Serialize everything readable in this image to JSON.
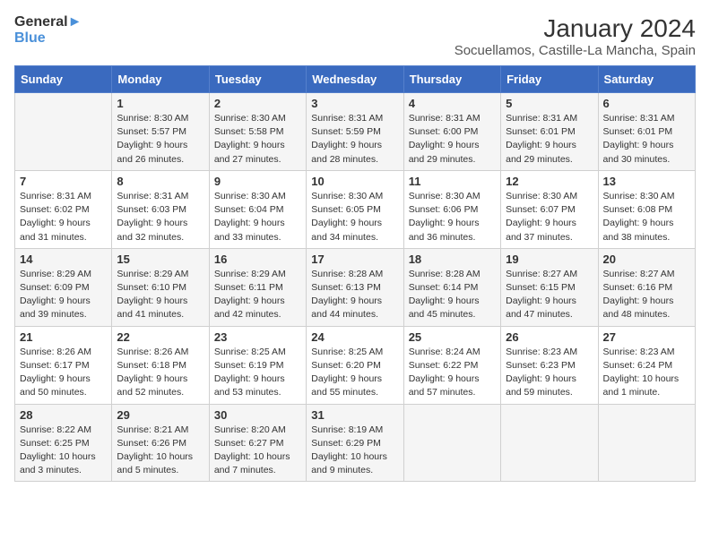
{
  "logo": {
    "line1": "General",
    "line2": "Blue"
  },
  "title": "January 2024",
  "location": "Socuellamos, Castille-La Mancha, Spain",
  "days_of_week": [
    "Sunday",
    "Monday",
    "Tuesday",
    "Wednesday",
    "Thursday",
    "Friday",
    "Saturday"
  ],
  "weeks": [
    [
      {
        "num": "",
        "sunrise": "",
        "sunset": "",
        "daylight": ""
      },
      {
        "num": "1",
        "sunrise": "Sunrise: 8:30 AM",
        "sunset": "Sunset: 5:57 PM",
        "daylight": "Daylight: 9 hours and 26 minutes."
      },
      {
        "num": "2",
        "sunrise": "Sunrise: 8:30 AM",
        "sunset": "Sunset: 5:58 PM",
        "daylight": "Daylight: 9 hours and 27 minutes."
      },
      {
        "num": "3",
        "sunrise": "Sunrise: 8:31 AM",
        "sunset": "Sunset: 5:59 PM",
        "daylight": "Daylight: 9 hours and 28 minutes."
      },
      {
        "num": "4",
        "sunrise": "Sunrise: 8:31 AM",
        "sunset": "Sunset: 6:00 PM",
        "daylight": "Daylight: 9 hours and 29 minutes."
      },
      {
        "num": "5",
        "sunrise": "Sunrise: 8:31 AM",
        "sunset": "Sunset: 6:01 PM",
        "daylight": "Daylight: 9 hours and 29 minutes."
      },
      {
        "num": "6",
        "sunrise": "Sunrise: 8:31 AM",
        "sunset": "Sunset: 6:01 PM",
        "daylight": "Daylight: 9 hours and 30 minutes."
      }
    ],
    [
      {
        "num": "7",
        "sunrise": "Sunrise: 8:31 AM",
        "sunset": "Sunset: 6:02 PM",
        "daylight": "Daylight: 9 hours and 31 minutes."
      },
      {
        "num": "8",
        "sunrise": "Sunrise: 8:31 AM",
        "sunset": "Sunset: 6:03 PM",
        "daylight": "Daylight: 9 hours and 32 minutes."
      },
      {
        "num": "9",
        "sunrise": "Sunrise: 8:30 AM",
        "sunset": "Sunset: 6:04 PM",
        "daylight": "Daylight: 9 hours and 33 minutes."
      },
      {
        "num": "10",
        "sunrise": "Sunrise: 8:30 AM",
        "sunset": "Sunset: 6:05 PM",
        "daylight": "Daylight: 9 hours and 34 minutes."
      },
      {
        "num": "11",
        "sunrise": "Sunrise: 8:30 AM",
        "sunset": "Sunset: 6:06 PM",
        "daylight": "Daylight: 9 hours and 36 minutes."
      },
      {
        "num": "12",
        "sunrise": "Sunrise: 8:30 AM",
        "sunset": "Sunset: 6:07 PM",
        "daylight": "Daylight: 9 hours and 37 minutes."
      },
      {
        "num": "13",
        "sunrise": "Sunrise: 8:30 AM",
        "sunset": "Sunset: 6:08 PM",
        "daylight": "Daylight: 9 hours and 38 minutes."
      }
    ],
    [
      {
        "num": "14",
        "sunrise": "Sunrise: 8:29 AM",
        "sunset": "Sunset: 6:09 PM",
        "daylight": "Daylight: 9 hours and 39 minutes."
      },
      {
        "num": "15",
        "sunrise": "Sunrise: 8:29 AM",
        "sunset": "Sunset: 6:10 PM",
        "daylight": "Daylight: 9 hours and 41 minutes."
      },
      {
        "num": "16",
        "sunrise": "Sunrise: 8:29 AM",
        "sunset": "Sunset: 6:11 PM",
        "daylight": "Daylight: 9 hours and 42 minutes."
      },
      {
        "num": "17",
        "sunrise": "Sunrise: 8:28 AM",
        "sunset": "Sunset: 6:13 PM",
        "daylight": "Daylight: 9 hours and 44 minutes."
      },
      {
        "num": "18",
        "sunrise": "Sunrise: 8:28 AM",
        "sunset": "Sunset: 6:14 PM",
        "daylight": "Daylight: 9 hours and 45 minutes."
      },
      {
        "num": "19",
        "sunrise": "Sunrise: 8:27 AM",
        "sunset": "Sunset: 6:15 PM",
        "daylight": "Daylight: 9 hours and 47 minutes."
      },
      {
        "num": "20",
        "sunrise": "Sunrise: 8:27 AM",
        "sunset": "Sunset: 6:16 PM",
        "daylight": "Daylight: 9 hours and 48 minutes."
      }
    ],
    [
      {
        "num": "21",
        "sunrise": "Sunrise: 8:26 AM",
        "sunset": "Sunset: 6:17 PM",
        "daylight": "Daylight: 9 hours and 50 minutes."
      },
      {
        "num": "22",
        "sunrise": "Sunrise: 8:26 AM",
        "sunset": "Sunset: 6:18 PM",
        "daylight": "Daylight: 9 hours and 52 minutes."
      },
      {
        "num": "23",
        "sunrise": "Sunrise: 8:25 AM",
        "sunset": "Sunset: 6:19 PM",
        "daylight": "Daylight: 9 hours and 53 minutes."
      },
      {
        "num": "24",
        "sunrise": "Sunrise: 8:25 AM",
        "sunset": "Sunset: 6:20 PM",
        "daylight": "Daylight: 9 hours and 55 minutes."
      },
      {
        "num": "25",
        "sunrise": "Sunrise: 8:24 AM",
        "sunset": "Sunset: 6:22 PM",
        "daylight": "Daylight: 9 hours and 57 minutes."
      },
      {
        "num": "26",
        "sunrise": "Sunrise: 8:23 AM",
        "sunset": "Sunset: 6:23 PM",
        "daylight": "Daylight: 9 hours and 59 minutes."
      },
      {
        "num": "27",
        "sunrise": "Sunrise: 8:23 AM",
        "sunset": "Sunset: 6:24 PM",
        "daylight": "Daylight: 10 hours and 1 minute."
      }
    ],
    [
      {
        "num": "28",
        "sunrise": "Sunrise: 8:22 AM",
        "sunset": "Sunset: 6:25 PM",
        "daylight": "Daylight: 10 hours and 3 minutes."
      },
      {
        "num": "29",
        "sunrise": "Sunrise: 8:21 AM",
        "sunset": "Sunset: 6:26 PM",
        "daylight": "Daylight: 10 hours and 5 minutes."
      },
      {
        "num": "30",
        "sunrise": "Sunrise: 8:20 AM",
        "sunset": "Sunset: 6:27 PM",
        "daylight": "Daylight: 10 hours and 7 minutes."
      },
      {
        "num": "31",
        "sunrise": "Sunrise: 8:19 AM",
        "sunset": "Sunset: 6:29 PM",
        "daylight": "Daylight: 10 hours and 9 minutes."
      },
      {
        "num": "",
        "sunrise": "",
        "sunset": "",
        "daylight": ""
      },
      {
        "num": "",
        "sunrise": "",
        "sunset": "",
        "daylight": ""
      },
      {
        "num": "",
        "sunrise": "",
        "sunset": "",
        "daylight": ""
      }
    ]
  ]
}
